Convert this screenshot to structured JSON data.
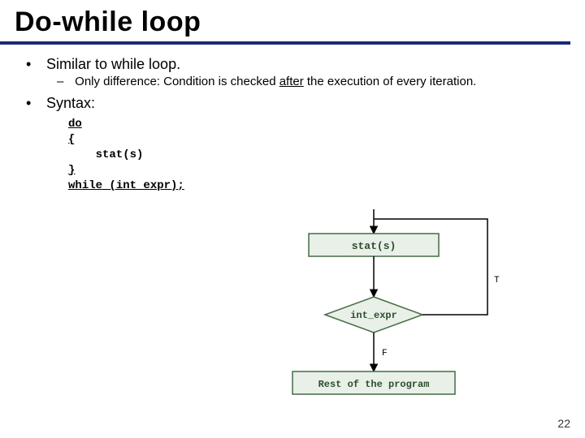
{
  "title": "Do-while loop",
  "bullets": {
    "b1": "Similar to while loop.",
    "b1_sub": "Only difference: Condition is checked ",
    "b1_sub_u": "after",
    "b1_sub_tail": " the execution of every iteration.",
    "b2": "Syntax:"
  },
  "code": {
    "l1": "do",
    "l2": "{",
    "l3": "    stat(s)",
    "l4": "}",
    "l5_a": "while",
    "l5_b": " (int_expr);"
  },
  "chart_data": {
    "type": "flowchart",
    "nodes": [
      {
        "id": "stat",
        "kind": "process",
        "label": "stat(s)"
      },
      {
        "id": "cond",
        "kind": "decision",
        "label": "int_expr"
      },
      {
        "id": "rest",
        "kind": "process",
        "label": "Rest of the program"
      }
    ],
    "edges": [
      {
        "from": "entry",
        "to": "stat"
      },
      {
        "from": "stat",
        "to": "cond"
      },
      {
        "from": "cond",
        "to": "stat",
        "label": "T",
        "loop": true
      },
      {
        "from": "cond",
        "to": "rest",
        "label": "F"
      }
    ]
  },
  "flow": {
    "stat": "stat(s)",
    "cond": "int_expr",
    "rest": "Rest of the program",
    "T": "T",
    "F": "F"
  },
  "page": "22"
}
